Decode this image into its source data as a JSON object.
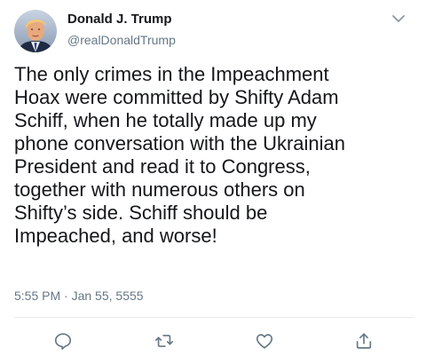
{
  "author": {
    "display_name": "Donald J. Trump",
    "handle": "@realDonaldTrump"
  },
  "tweet": {
    "lines": [
      "The only crimes in the Impeachment",
      "Hoax were committed by Shifty Adam",
      "Schiff, when he totally made up my",
      "phone conversation with the Ukrainian",
      "President and read it to Congress,",
      "together with numerous others on",
      "Shifty’s side. Schiff should be",
      "Impeached, and worse!"
    ],
    "time": "5:55 PM",
    "separator": "·",
    "date": "Jan 55, 5555"
  },
  "icons": {
    "more": "chevron-down-icon",
    "reply": "reply-icon",
    "retweet": "retweet-icon",
    "like": "heart-icon",
    "share": "share-icon"
  },
  "colors": {
    "text": "#14171a",
    "secondary": "#657786",
    "divider": "#e6ecf0",
    "icon": "#657786"
  }
}
